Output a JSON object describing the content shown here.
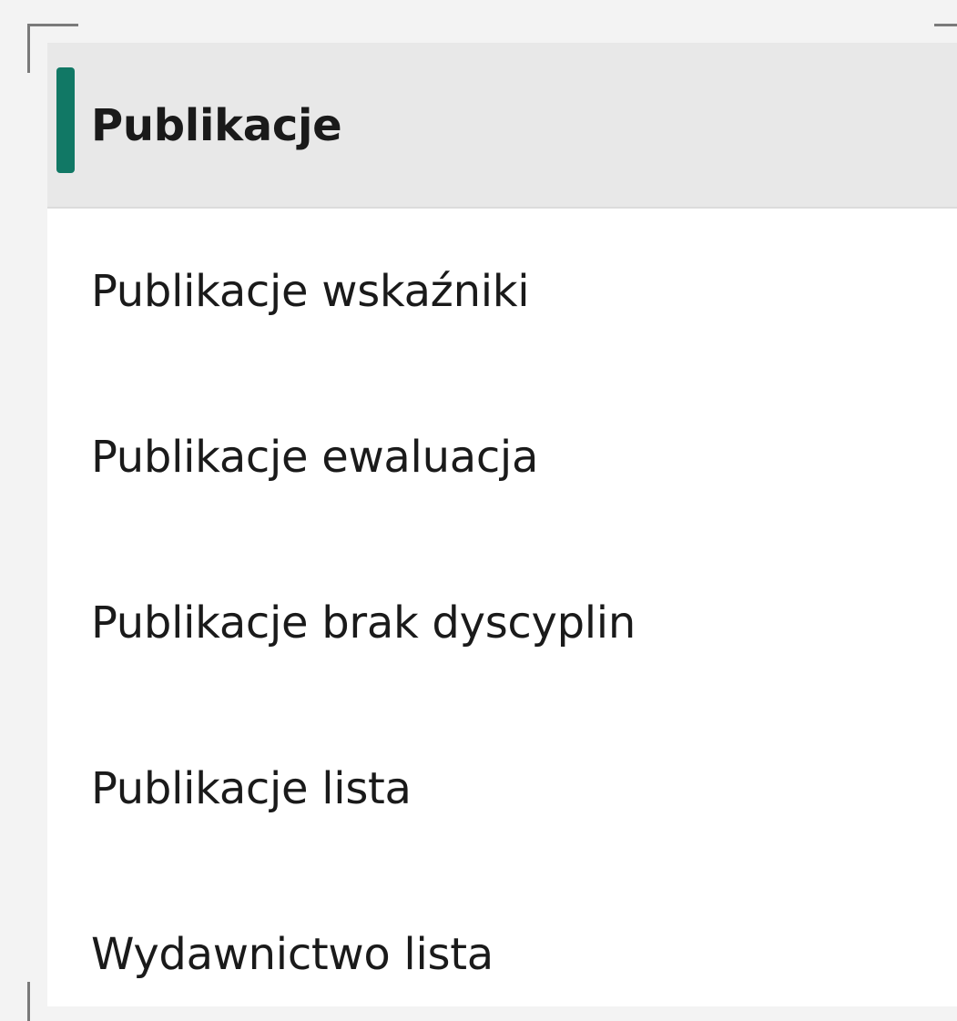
{
  "colors": {
    "accent": "#117865",
    "selected_background": "#e8e8e8",
    "list_background": "#ffffff",
    "window_background": "#f3f3f3",
    "text": "#1a1a1a"
  },
  "pages": {
    "selected_index": 0,
    "items": [
      {
        "label": "Publikacje"
      },
      {
        "label": "Publikacje wskaźniki"
      },
      {
        "label": "Publikacje ewaluacja"
      },
      {
        "label": "Publikacje brak dyscyplin"
      },
      {
        "label": "Publikacje lista"
      },
      {
        "label": "Wydawnictwo lista"
      }
    ]
  }
}
